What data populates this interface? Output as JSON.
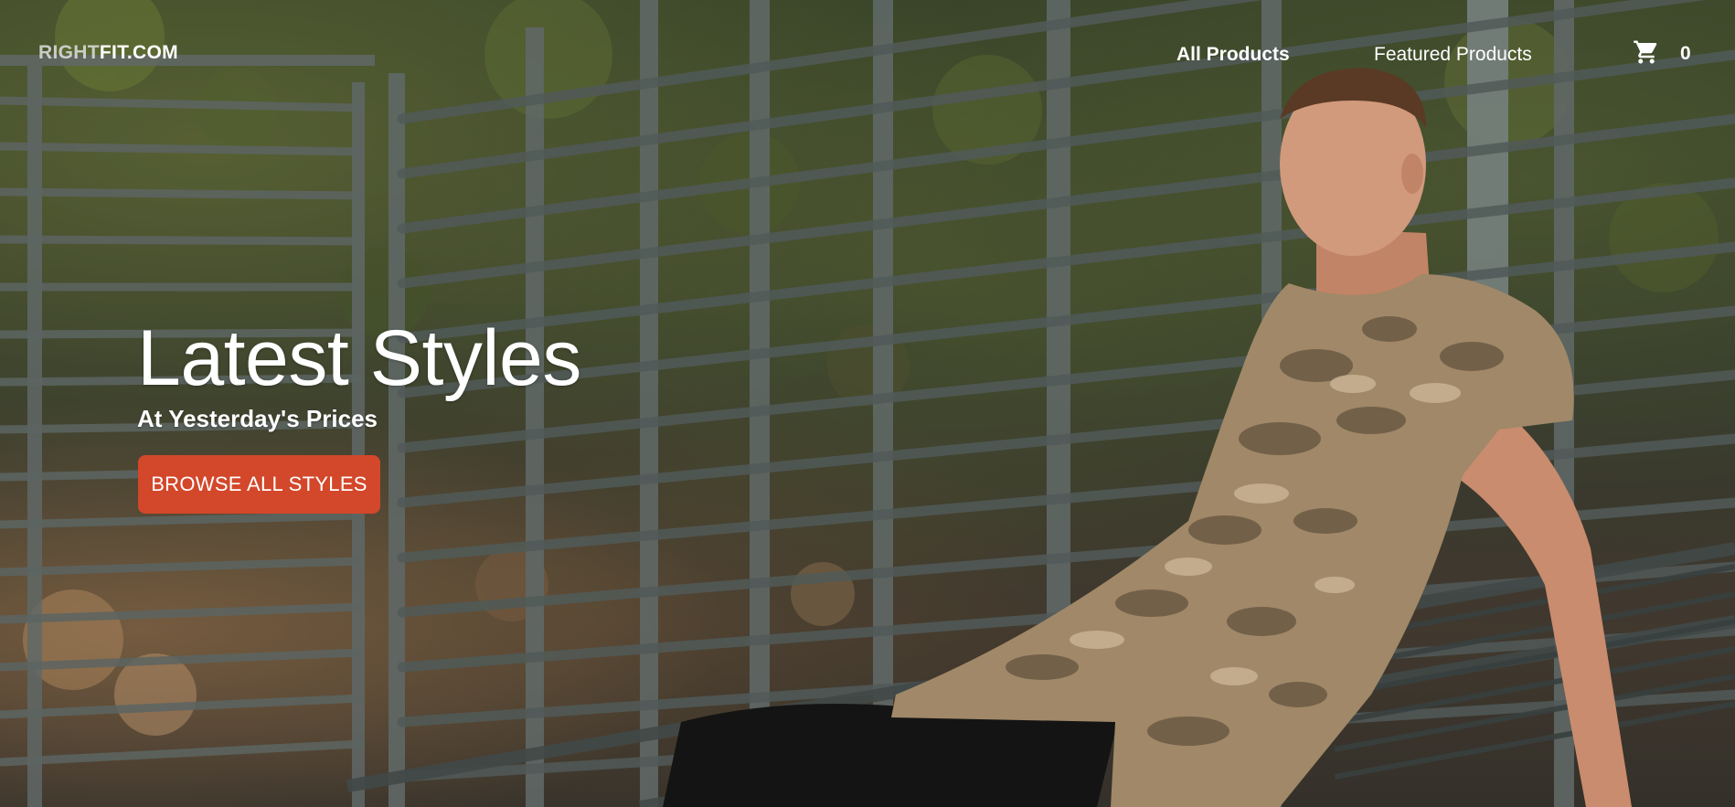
{
  "header": {
    "brand_prefix": "RIGHT",
    "brand_suffix": "FIT.COM",
    "nav_all_products": "All Products",
    "nav_featured_products": "Featured Products",
    "cart_icon": "shopping-cart-icon",
    "cart_count": "0"
  },
  "hero": {
    "title": "Latest Styles",
    "subtitle": "At Yesterday's Prices",
    "cta_label": "BROWSE ALL STYLES",
    "cta_color": "#d3472a",
    "background_photo": "man-in-camo-shirt-leaning-on-metal-fence"
  },
  "colors": {
    "text": "#ffffff",
    "accent": "#d3472a"
  }
}
